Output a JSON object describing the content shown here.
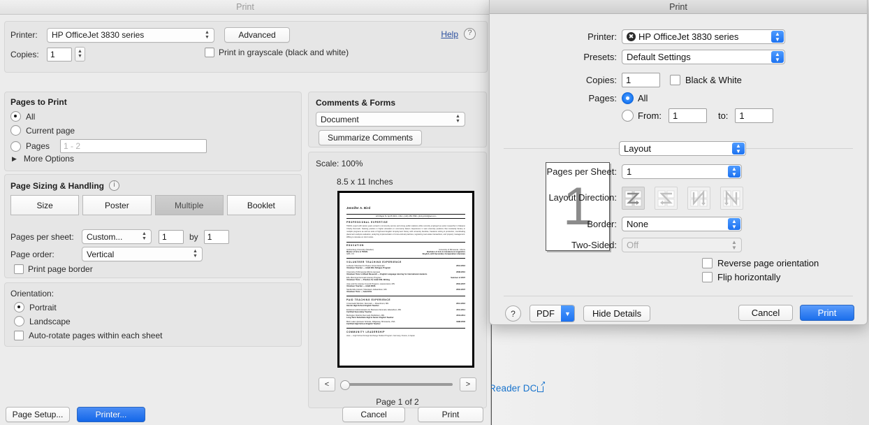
{
  "background": {
    "link_text": "Reader DC",
    "link_icon": "external-link-icon"
  },
  "acrobat_dialog": {
    "title": "Print",
    "printer": {
      "label": "Printer:",
      "value": "HP OfficeJet 3830 series",
      "advanced_button": "Advanced"
    },
    "copies": {
      "label": "Copies:",
      "value": "1"
    },
    "grayscale_checkbox": {
      "label": "Print in grayscale (black and white)",
      "checked": false
    },
    "help": {
      "link": "Help",
      "icon": "question-mark-icon"
    },
    "pages_to_print": {
      "title": "Pages to Print",
      "options": [
        {
          "label": "All",
          "selected": true
        },
        {
          "label": "Current page",
          "selected": false
        },
        {
          "label": "Pages",
          "selected": false
        }
      ],
      "pages_input_placeholder": "1 - 2",
      "more_options": "More Options"
    },
    "page_sizing": {
      "title": "Page Sizing & Handling",
      "info_icon": "info-icon",
      "segments": [
        {
          "label": "Size",
          "active": false
        },
        {
          "label": "Poster",
          "active": false
        },
        {
          "label": "Multiple",
          "active": true
        },
        {
          "label": "Booklet",
          "active": false
        }
      ],
      "pages_per_sheet_label": "Pages per sheet:",
      "pages_per_sheet_value": "Custom...",
      "cols_value": "1",
      "by_label": "by",
      "rows_value": "1",
      "page_order_label": "Page order:",
      "page_order_value": "Vertical",
      "print_page_border": {
        "label": "Print page border",
        "checked": false
      }
    },
    "orientation": {
      "label": "Orientation:",
      "options": [
        {
          "label": "Portrait",
          "selected": true
        },
        {
          "label": "Landscape",
          "selected": false
        }
      ],
      "auto_rotate": {
        "label": "Auto-rotate pages within each sheet",
        "checked": false
      }
    },
    "comments_forms": {
      "title": "Comments & Forms",
      "value": "Document",
      "summarize_button": "Summarize Comments"
    },
    "preview": {
      "scale": "Scale: 100%",
      "paper_size": "8.5 x 11 Inches",
      "page_indicator": "Page 1 of 2",
      "prev_button": "<",
      "next_button": ">"
    },
    "footer": {
      "page_setup": "Page Setup...",
      "printer": "Printer...",
      "cancel": "Cancel",
      "print": "Print"
    },
    "document_preview": {
      "name": "Jennifer A. Bird",
      "contact": "123 Maple St. Apt B #201  •  USA  •  (123) 456-7890  •  jbird.jmbird@aol.com",
      "sections": [
        {
          "heading": "PROFESSIONAL EXPERTISE",
          "body": "TESOL expert with twelve years versed in community service and strong public relations while currently employed as senior researcher in Nakamo Charity Denmark. Seeking position in higher education or community liaison. Experience in vast university positions that constantly literacy in multiple programs as well as tools of high-level English. Employment history with university faculties, freelance writing & production, coordinating placement analysis evaluation, analyzing implementation of cross-cultural practices, registering real estate transactions, and property management. Willing to relocate on short notice."
        },
        {
          "heading": "EDUCATION",
          "entries": [
            {
              "left1": "Gothenburg University (Sweden)",
              "left2": "Master of Arts in TESOL",
              "left3": "GPA: 3.9",
              "right1": "University of Minnesota - Morris",
              "right2": "Bachelor of Arts in Literature & Linguistics",
              "right3": "English, with Secondary Comparative Literature"
            }
          ]
        },
        {
          "heading": "VOLUNTEER TEACHING EXPERIENCE",
          "entries": [
            {
              "left1": "Lutheran Volunteer for Peace Corps Denmark",
              "left2": "Volunteer Teacher — Adult ESL Refugee Program",
              "right1": "2013-2016"
            },
            {
              "left1": "University of Minnesota (Morris campus)",
              "left2": "Volunteer Tutor in Mixed Research — English Language tutoring for international students",
              "right1": "2008-2010"
            },
            {
              "left1": "ESL Mornings Denmark Literacy Program",
              "left2": "Volunteer Tutor — Practice for Adult ESL Writing",
              "right1": "Summer of 2007"
            },
            {
              "left1": "Jose and the Literacy Council Program, Lawrenceton, MN",
              "left2": "Volunteer Teacher — Adult ESOL",
              "right1": "2004-2007"
            },
            {
              "left1": "Sanderville Literacy Volunteers, Edwardson, MN",
              "left2": "Volunteer Tutor — Adult ESL",
              "right1": "2004-2007"
            }
          ]
        },
        {
          "heading": "PAID TEACHING EXPERIENCE",
          "entries": [
            {
              "left1": "Crossroads Windsor, Denmark — Rosenhorst, MN",
              "left2": "Interim High School English Teacher",
              "right1": "2014-2016"
            },
            {
              "left1": "Enlistment Administrators for Business Denmark, Edwardson, MN",
              "left2": "Certified Secondary Teacher",
              "right1": "2011-2014"
            },
            {
              "left1": "Burlington Districts Denmark, Bethlehem, MN",
              "left2": "Long-Term Substitute High & Senior English Teacher",
              "right1": "2010-2011"
            },
            {
              "left1": "Birch Lake Upstream Schools, Ridgeway, Minnesota, USA",
              "left2": "Certified High School English Teacher",
              "right1": "1998-2002"
            }
          ]
        },
        {
          "heading": "COMMUNITY LEADERSHIP",
          "body": "Host — High School Foreign Exchange Student Program: Germany, France, & Japan"
        }
      ]
    }
  },
  "mac_dialog": {
    "title": "Print",
    "printer": {
      "label": "Printer:",
      "value": "HP OfficeJet 3830 series",
      "icon": "printer-status-icon"
    },
    "presets": {
      "label": "Presets:",
      "value": "Default Settings"
    },
    "copies": {
      "label": "Copies:",
      "value": "1"
    },
    "black_and_white": {
      "label": "Black & White",
      "checked": false
    },
    "pages": {
      "label": "Pages:",
      "all_label": "All",
      "all_selected": true,
      "from_label": "From:",
      "from_value": "1",
      "to_label": "to:",
      "to_value": "1",
      "range_selected": false
    },
    "pane_selector": {
      "value": "Layout"
    },
    "preview": {
      "page_number": "1"
    },
    "layout": {
      "pages_per_sheet": {
        "label": "Pages per Sheet:",
        "value": "1"
      },
      "layout_direction": {
        "label": "Layout Direction:",
        "options": [
          {
            "name": "layout-direction-z-right",
            "selected": true
          },
          {
            "name": "layout-direction-z-left",
            "selected": false
          },
          {
            "name": "layout-direction-n-down-right",
            "selected": false
          },
          {
            "name": "layout-direction-n-down-left",
            "selected": false
          }
        ]
      },
      "border": {
        "label": "Border:",
        "value": "None"
      },
      "two_sided": {
        "label": "Two-Sided:",
        "value": "Off",
        "disabled": true
      },
      "reverse_page_orientation": {
        "label": "Reverse page orientation",
        "checked": false
      },
      "flip_horizontally": {
        "label": "Flip horizontally",
        "checked": false
      }
    },
    "footer": {
      "help_icon": "question-mark-icon",
      "pdf_button": "PDF",
      "pdf_chevron_icon": "chevron-down-icon",
      "hide_details": "Hide Details",
      "cancel": "Cancel",
      "print": "Print"
    }
  }
}
